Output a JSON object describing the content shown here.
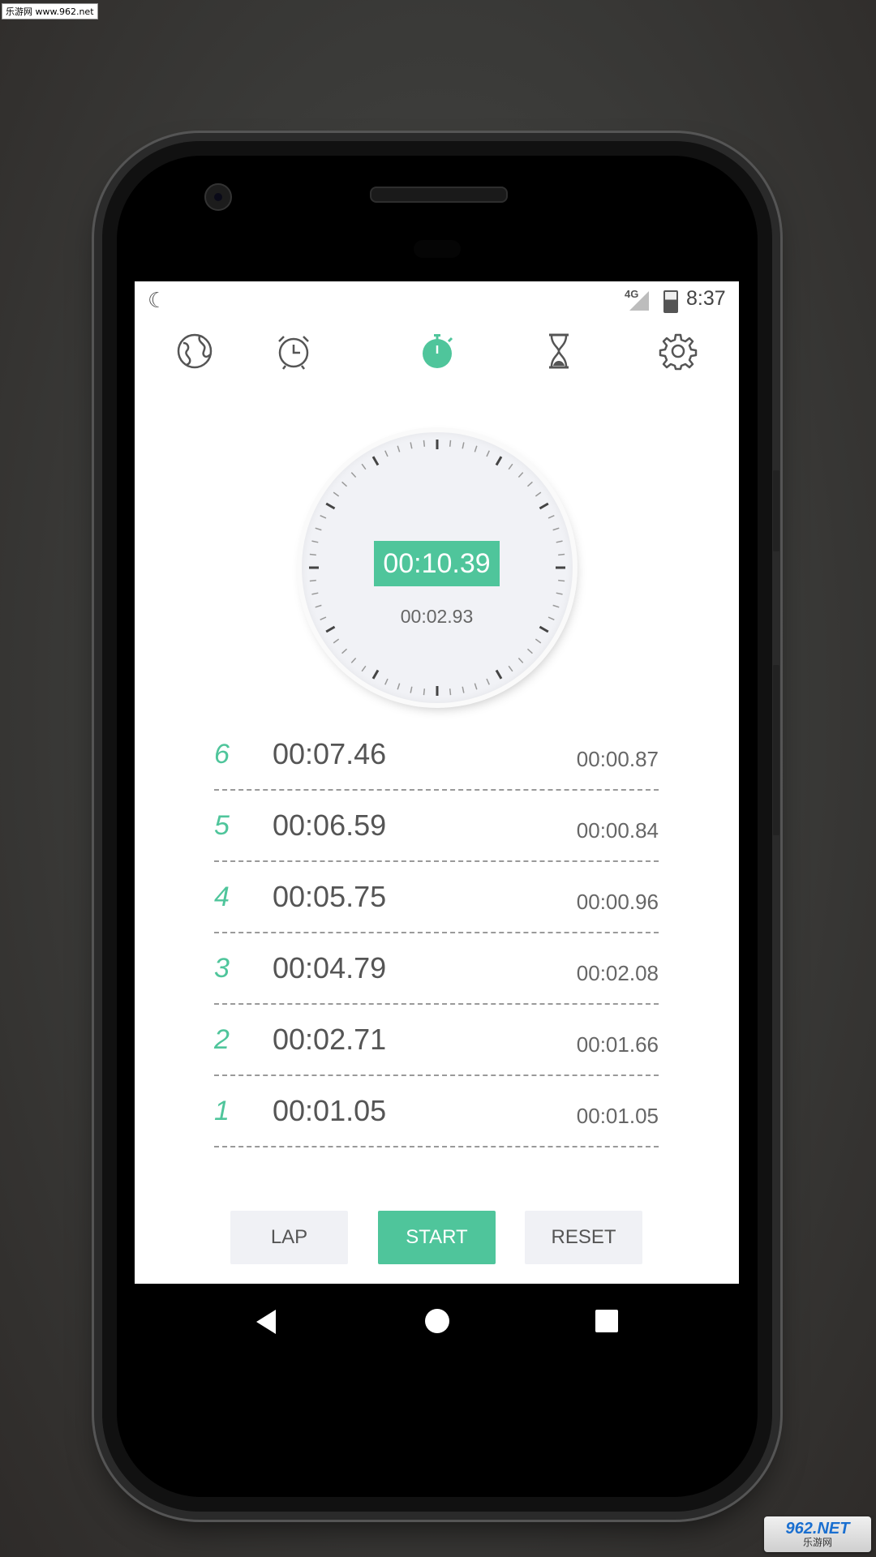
{
  "watermark": {
    "top_text": "乐游网 www.962.net",
    "bottom_big": "962.NET",
    "bottom_small": "乐游网"
  },
  "statusbar": {
    "network": "4G",
    "time": "8:37"
  },
  "tabs": [
    {
      "icon": "globe-icon",
      "active": false
    },
    {
      "icon": "alarm-clock-icon",
      "active": true
    },
    {
      "icon": "stopwatch-icon",
      "active": true
    },
    {
      "icon": "hourglass-icon",
      "active": false
    },
    {
      "icon": "gear-icon",
      "active": false
    }
  ],
  "stopwatch": {
    "main_time": "00:10.39",
    "sub_time": "00:02.93"
  },
  "laps": [
    {
      "num": "6",
      "total": "00:07.46",
      "split": "00:00.87"
    },
    {
      "num": "5",
      "total": "00:06.59",
      "split": "00:00.84"
    },
    {
      "num": "4",
      "total": "00:05.75",
      "split": "00:00.96"
    },
    {
      "num": "3",
      "total": "00:04.79",
      "split": "00:02.08"
    },
    {
      "num": "2",
      "total": "00:02.71",
      "split": "00:01.66"
    },
    {
      "num": "1",
      "total": "00:01.05",
      "split": "00:01.05"
    }
  ],
  "buttons": {
    "lap": "LAP",
    "start": "START",
    "reset": "RESET"
  },
  "colors": {
    "accent": "#4fc59b",
    "icon_gray": "#555555"
  }
}
